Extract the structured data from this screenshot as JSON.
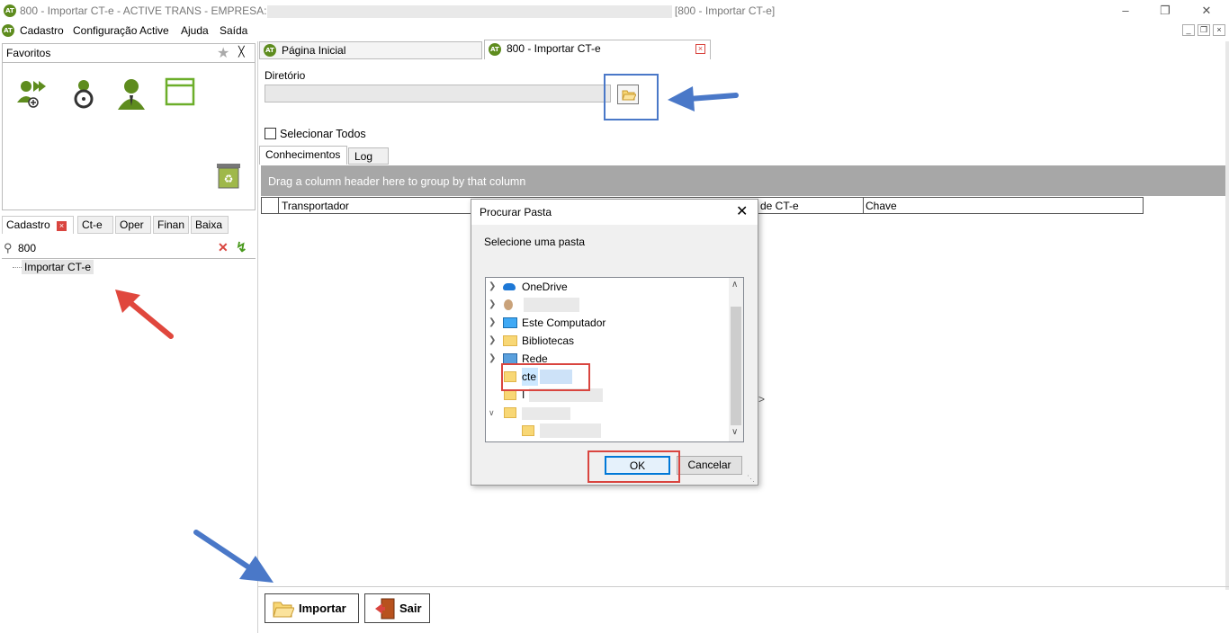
{
  "window": {
    "title_prefix": "800 - Importar CT-e - ACTIVE TRANS - EMPRESA:",
    "title_suffix": "[800 - Importar CT-e]",
    "logo_text": "AT"
  },
  "menu": [
    "Cadastro",
    "Configuração Active",
    "Ajuda",
    "Saída"
  ],
  "favorites": {
    "title": "Favoritos"
  },
  "left_tabs": [
    "Cadastro",
    "Ct-e",
    "Oper",
    "Finan",
    "Baixa"
  ],
  "search": {
    "value": "800"
  },
  "tree": {
    "item": "Importar CT-e"
  },
  "main_tabs": [
    "Página Inicial",
    "800 - Importar CT-e"
  ],
  "directory": {
    "label": "Diretório",
    "value": ""
  },
  "select_all": {
    "label": "Selecionar Todos"
  },
  "inner_tabs": [
    "Conhecimentos",
    "Log"
  ],
  "grid": {
    "group_hint": "Drag a column header here to group by that column",
    "columns": [
      "Transportador",
      "de CT-e",
      "Chave"
    ],
    "partial_text": ">"
  },
  "dialog": {
    "title": "Procurar Pasta",
    "prompt": "Selecione uma pasta",
    "tree": [
      "OneDrive",
      "",
      "Este Computador",
      "Bibliotecas",
      "Rede",
      "cte",
      "I",
      "",
      ""
    ],
    "ok": "OK",
    "cancel": "Cancelar"
  },
  "buttons": {
    "import": "Importar",
    "exit": "Sair"
  },
  "colors": {
    "arrow_blue": "#4a78c8",
    "arrow_red": "#e0473d",
    "logo_green": "#5e8c1e",
    "highlight_red": "#d9453f"
  }
}
